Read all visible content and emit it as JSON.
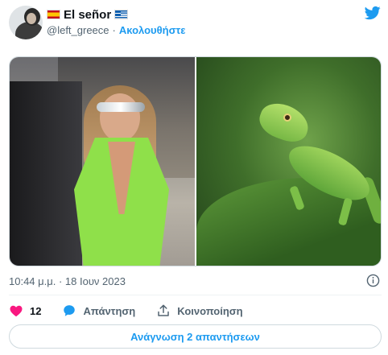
{
  "author": {
    "display_name": "El señor",
    "handle": "@left_greece",
    "separator": "·",
    "follow_label": "Ακολουθήστε",
    "flags": [
      "spain-flag",
      "greece-flag"
    ]
  },
  "media": {
    "images": [
      {
        "icon": "woman-in-green-outfit-photo"
      },
      {
        "icon": "green-lizard-photo"
      }
    ]
  },
  "meta": {
    "timestamp": "10:44 μ.μ. · 18 Ιουν 2023"
  },
  "actions": {
    "like_count": "12",
    "reply_label": "Απάντηση",
    "share_label": "Κοινοποίηση"
  },
  "replies_button": {
    "label": "Ανάγνωση 2 απαντήσεων"
  },
  "colors": {
    "accent": "#1d9bf0",
    "like": "#f91880",
    "text_secondary": "#536471"
  }
}
